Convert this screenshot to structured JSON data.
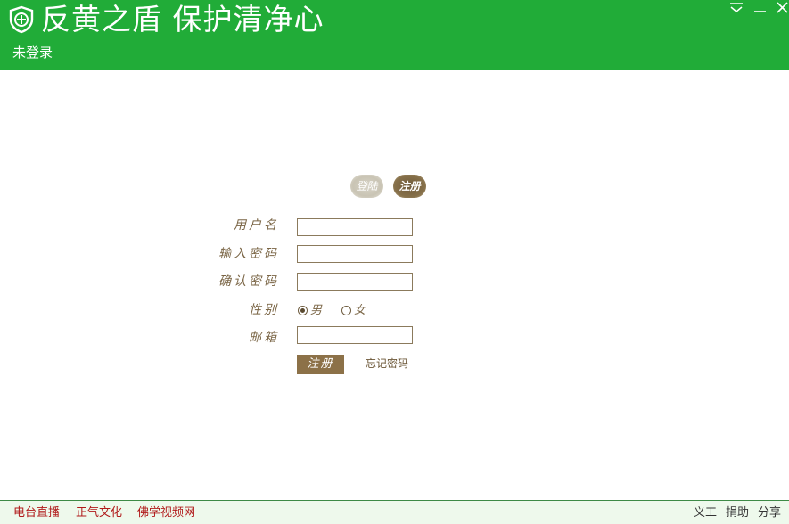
{
  "header": {
    "title": "反黄之盾 保护清净心",
    "login_status": "未登录"
  },
  "tabs": {
    "login": "登陆",
    "register": "注册"
  },
  "form": {
    "username_label": "用户名",
    "password_label": "输入密码",
    "confirm_label": "确认密码",
    "gender_label": "性别",
    "gender_male": "男",
    "gender_female": "女",
    "gender_selected": "男",
    "email_label": "邮箱",
    "username_value": "",
    "password_value": "",
    "confirm_value": "",
    "email_value": "",
    "submit_label": "注册",
    "forgot_label": "忘记密码"
  },
  "footer": {
    "links_left": [
      "电台直播",
      "正气文化",
      "佛学视频网"
    ],
    "links_right": [
      "义工",
      "捐助",
      "分享"
    ]
  },
  "colors": {
    "header_bg": "#21ac38",
    "accent_brown": "#8c7148",
    "footer_link": "#b01a1a"
  },
  "icons": {
    "logo": "shield-plus-icon",
    "menu": "dropdown-menu-icon",
    "minimize": "minimize-icon",
    "close": "close-icon"
  }
}
